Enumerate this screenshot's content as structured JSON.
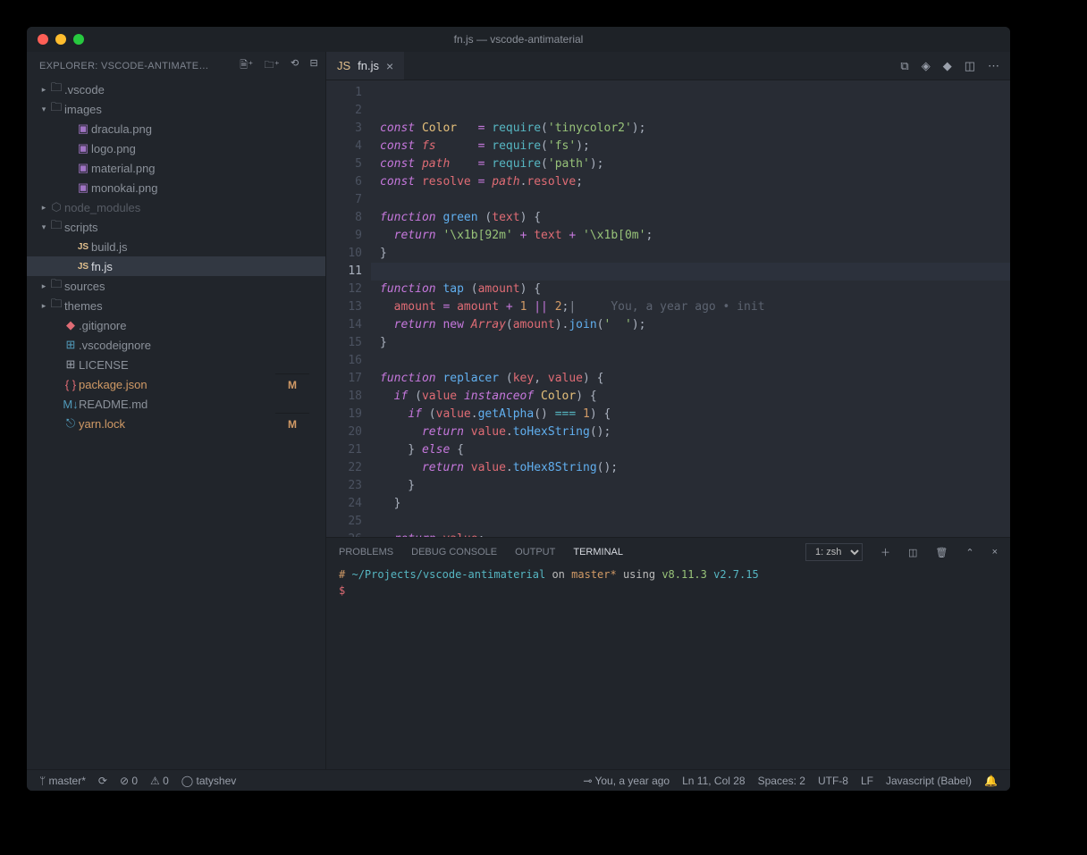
{
  "titlebar": "fn.js — vscode-antimaterial",
  "explorerHeader": "EXPLORER: VSCODE-ANTIMATE…",
  "tree": [
    {
      "type": "folder",
      "label": ".vscode",
      "ind": 1,
      "caret": "▸",
      "icon": "fold"
    },
    {
      "type": "folder",
      "label": "images",
      "ind": 1,
      "caret": "▾",
      "icon": "fold"
    },
    {
      "type": "file",
      "label": "dracula.png",
      "ind": 3,
      "icon": "img"
    },
    {
      "type": "file",
      "label": "logo.png",
      "ind": 3,
      "icon": "img"
    },
    {
      "type": "file",
      "label": "material.png",
      "ind": 3,
      "icon": "img"
    },
    {
      "type": "file",
      "label": "monokai.png",
      "ind": 3,
      "icon": "img"
    },
    {
      "type": "folder",
      "label": "node_modules",
      "ind": 1,
      "caret": "▸",
      "icon": "node",
      "dim": true
    },
    {
      "type": "folder",
      "label": "scripts",
      "ind": 1,
      "caret": "▾",
      "icon": "fold"
    },
    {
      "type": "file",
      "label": "build.js",
      "ind": 3,
      "icon": "js"
    },
    {
      "type": "file",
      "label": "fn.js",
      "ind": 3,
      "icon": "js",
      "active": true
    },
    {
      "type": "folder",
      "label": "sources",
      "ind": 1,
      "caret": "▸",
      "icon": "fold"
    },
    {
      "type": "folder",
      "label": "themes",
      "ind": 1,
      "caret": "▸",
      "icon": "fold"
    },
    {
      "type": "file",
      "label": ".gitignore",
      "ind": 2,
      "icon": "git"
    },
    {
      "type": "file",
      "label": ".vscodeignore",
      "ind": 2,
      "icon": "vs"
    },
    {
      "type": "file",
      "label": "LICENSE",
      "ind": 2,
      "icon": "lic"
    },
    {
      "type": "file",
      "label": "package.json",
      "ind": 2,
      "icon": "pkg",
      "mod": "M"
    },
    {
      "type": "file",
      "label": "README.md",
      "ind": 2,
      "icon": "md"
    },
    {
      "type": "file",
      "label": "yarn.lock",
      "ind": 2,
      "icon": "lock",
      "mod": "M"
    }
  ],
  "tab": {
    "label": "fn.js"
  },
  "blame": "You, a year ago • init",
  "lines": 26,
  "highlightLine": 11,
  "panel": {
    "tabs": [
      "PROBLEMS",
      "DEBUG CONSOLE",
      "OUTPUT",
      "TERMINAL"
    ],
    "active": "TERMINAL",
    "selector": "1: zsh",
    "prompt": {
      "hash": "#",
      "path": "~/Projects/vscode-antimaterial",
      "on": "on",
      "branch": "master*",
      "using": "using",
      "v1": "v8.11.3",
      "v2": "v2.7.15",
      "ps": "$"
    }
  },
  "status": {
    "branch": "master*",
    "sync": "⟳",
    "errors": "⊘ 0",
    "warnings": "⚠ 0",
    "gh": "tatyshev",
    "blame": "You, a year ago",
    "pos": "Ln 11, Col 28",
    "spaces": "Spaces: 2",
    "enc": "UTF-8",
    "eol": "LF",
    "lang": "Javascript (Babel)"
  }
}
